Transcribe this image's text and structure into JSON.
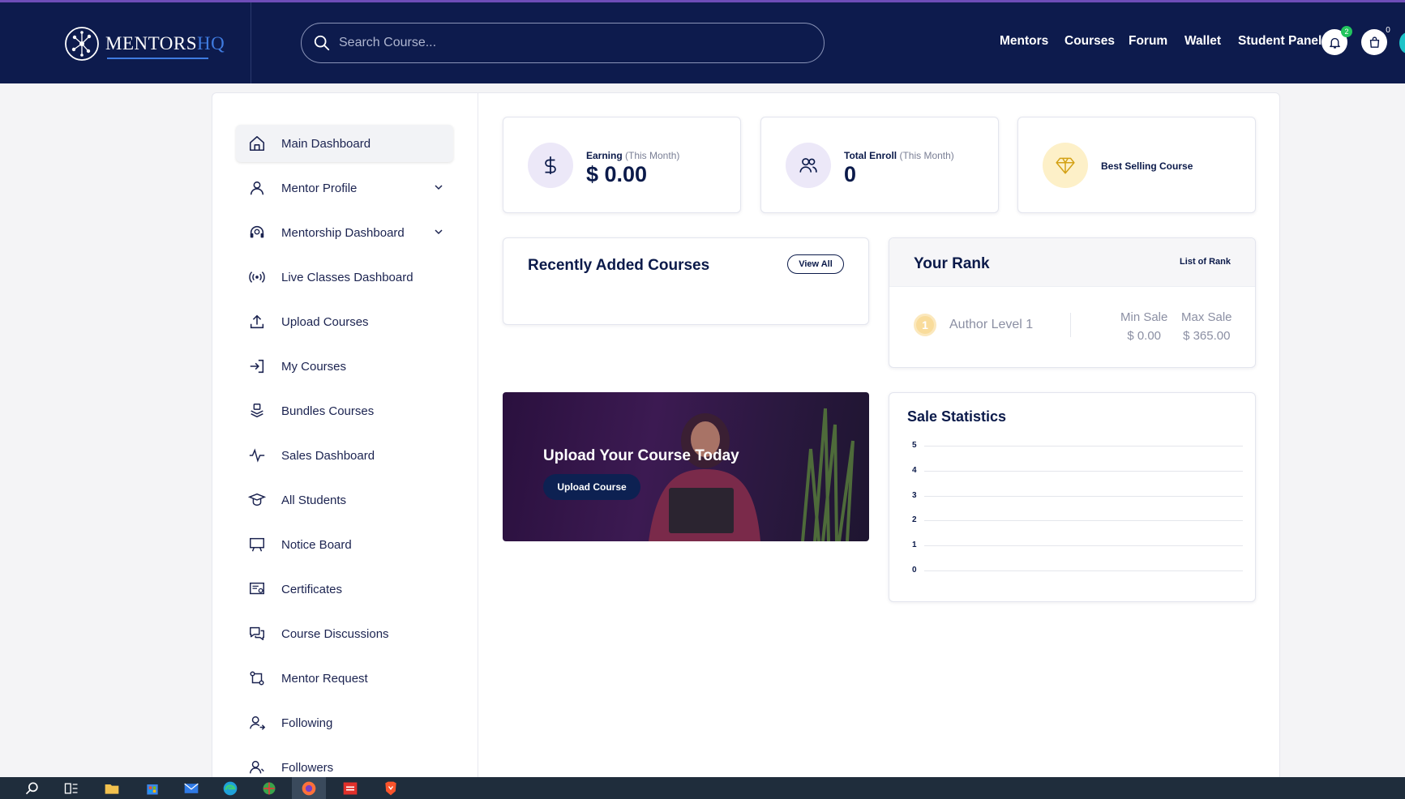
{
  "header": {
    "logo_text": "MENTORS",
    "logo_accent": "HQ",
    "search_placeholder": "Search Course...",
    "nav": [
      "Mentors",
      "Courses",
      "Forum",
      "Wallet",
      "Student Panel"
    ],
    "notification_count": "2",
    "cart_count": "0"
  },
  "sidebar": {
    "items": [
      {
        "label": "Main Dashboard",
        "icon": "home-icon",
        "active": true
      },
      {
        "label": "Mentor Profile",
        "icon": "user-icon",
        "expandable": true
      },
      {
        "label": "Mentorship Dashboard",
        "icon": "headset-icon",
        "expandable": true
      },
      {
        "label": "Live Classes Dashboard",
        "icon": "broadcast-icon"
      },
      {
        "label": "Upload Courses",
        "icon": "upload-icon"
      },
      {
        "label": "My Courses",
        "icon": "login-icon"
      },
      {
        "label": "Bundles Courses",
        "icon": "bundle-icon"
      },
      {
        "label": "Sales Dashboard",
        "icon": "activity-icon"
      },
      {
        "label": "All Students",
        "icon": "graduation-icon"
      },
      {
        "label": "Notice Board",
        "icon": "board-icon"
      },
      {
        "label": "Certificates",
        "icon": "certificate-icon"
      },
      {
        "label": "Course Discussions",
        "icon": "chat-icon"
      },
      {
        "label": "Mentor Request",
        "icon": "request-icon"
      },
      {
        "label": "Following",
        "icon": "following-icon"
      },
      {
        "label": "Followers",
        "icon": "followers-icon"
      }
    ]
  },
  "stats": {
    "earning": {
      "label": "Earning",
      "period": "(This Month)",
      "value": "$ 0.00"
    },
    "enroll": {
      "label": "Total Enroll",
      "period": "(This Month)",
      "value": "0"
    },
    "best": {
      "label": "Best Selling Course"
    }
  },
  "recent": {
    "title": "Recently Added Courses",
    "view_all": "View All"
  },
  "rank": {
    "title": "Your Rank",
    "list_link": "List of Rank",
    "medal": "1",
    "level": "Author Level 1",
    "min_label": "Min Sale",
    "min_value": "$ 0.00",
    "max_label": "Max Sale",
    "max_value": "$ 365.00"
  },
  "banner": {
    "title": "Upload Your Course Today",
    "button": "Upload Course"
  },
  "chart_data": {
    "type": "line",
    "title": "Sale Statistics",
    "ylim": [
      0,
      5
    ],
    "yticks": [
      "5",
      "4",
      "3",
      "2",
      "1",
      "0"
    ],
    "series": []
  },
  "colors": {
    "navy": "#0d1b4d",
    "accent_blue": "#3f7be0",
    "badge_green": "#22c55e"
  }
}
